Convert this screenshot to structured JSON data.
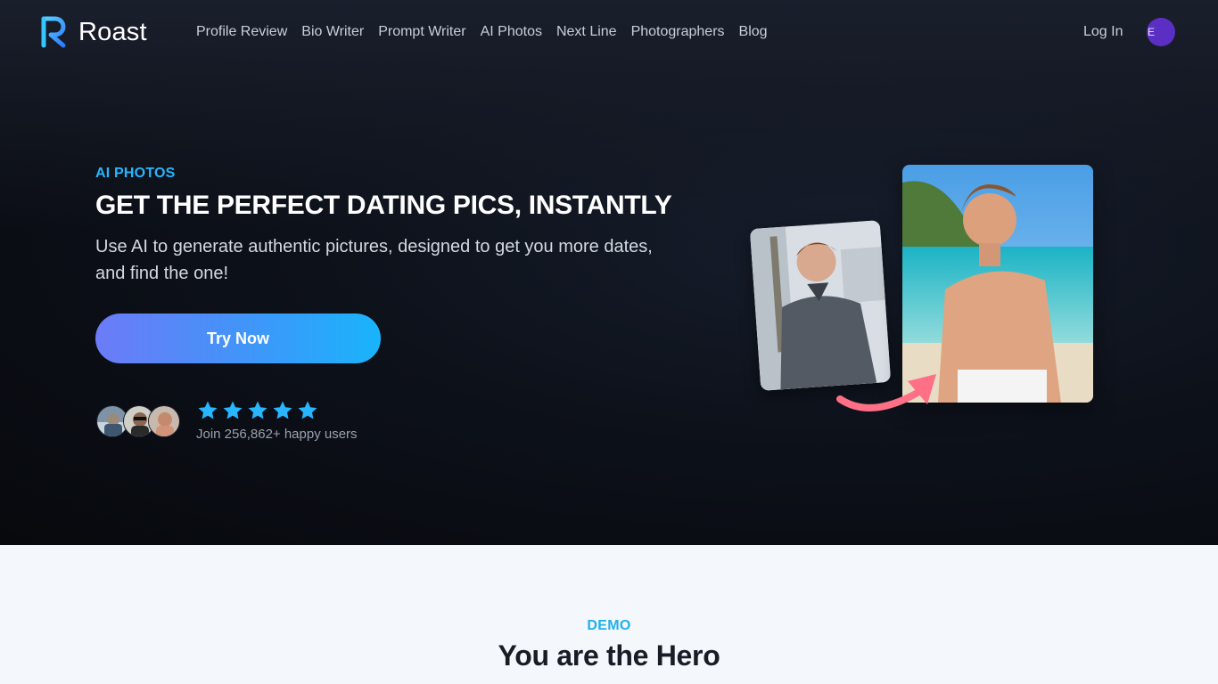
{
  "brand": {
    "name": "Roast",
    "accent": "#27b6ff"
  },
  "nav": {
    "items": [
      {
        "label": "Profile Review"
      },
      {
        "label": "Bio Writer"
      },
      {
        "label": "Prompt Writer"
      },
      {
        "label": "AI Photos"
      },
      {
        "label": "Next Line"
      },
      {
        "label": "Photographers"
      },
      {
        "label": "Blog"
      }
    ],
    "login_label": "Log In",
    "user_initial": "E"
  },
  "hero": {
    "eyebrow": "AI PHOTOS",
    "title": "GET THE PERFECT DATING PICS, INSTANTLY",
    "subtitle": "Use AI to generate authentic pictures, designed to get you more dates, and find the one!",
    "cta_label": "Try Now",
    "rating": {
      "stars": 5,
      "max": 5
    },
    "social_proof": "Join 256,862+ happy users"
  },
  "demo": {
    "eyebrow": "DEMO",
    "title": "You are the Hero"
  }
}
